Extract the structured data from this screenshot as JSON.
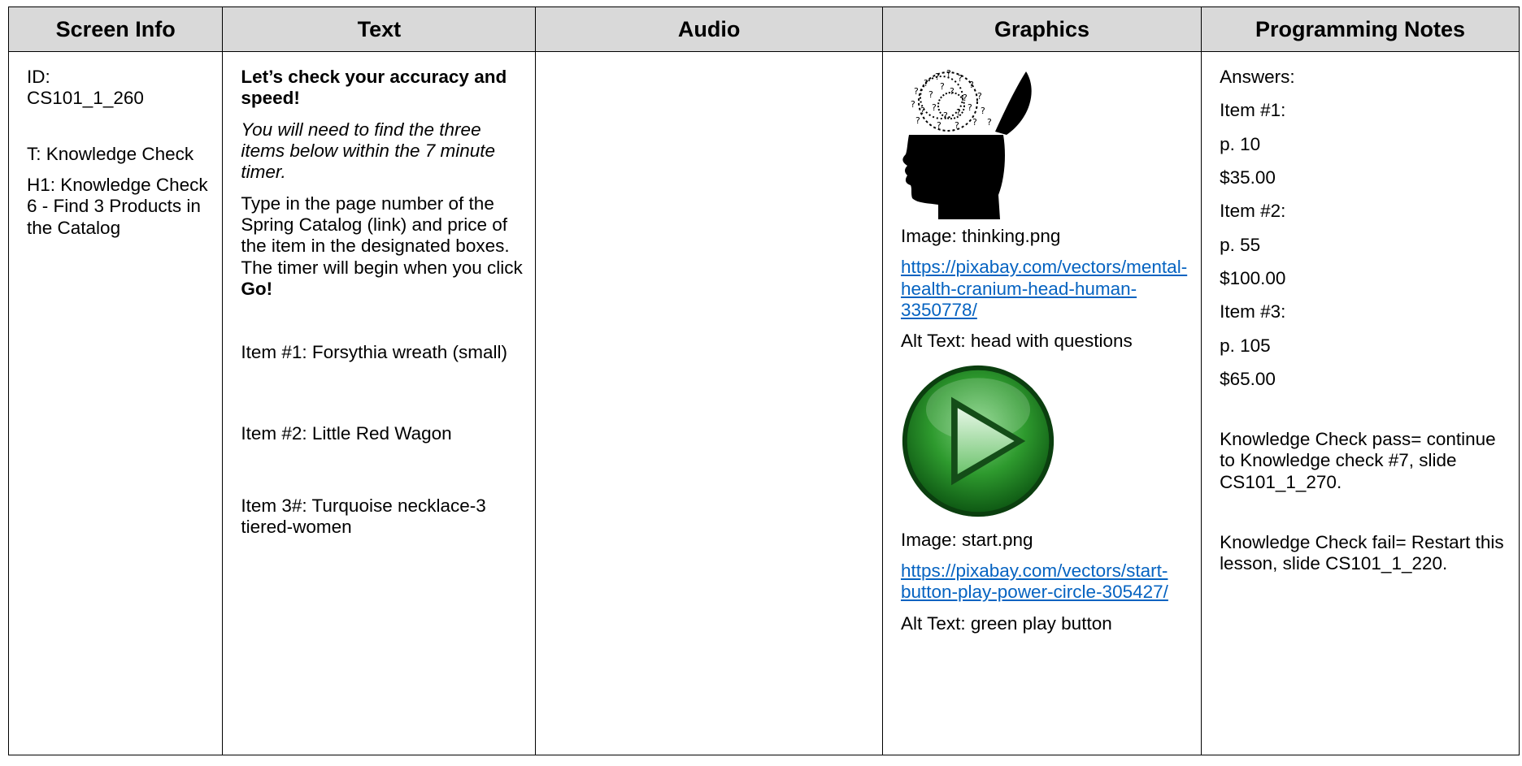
{
  "headers": {
    "screen_info": "Screen Info",
    "text": "Text",
    "audio": "Audio",
    "graphics": "Graphics",
    "programming_notes": "Programming Notes"
  },
  "screen_info": {
    "id_label": "ID:",
    "id_value": "CS101_1_260",
    "title": "T: Knowledge Check",
    "heading": "H1: Knowledge Check 6 - Find 3 Products in the Catalog"
  },
  "text": {
    "intro_bold": "Let’s check your accuracy and speed!",
    "instructions_italic": "You will need to find the three items below within the 7 minute timer.",
    "body_prefix": "Type in the page number of the Spring Catalog (link) and price of the item in the designated boxes. The timer will begin when you click",
    "body_go": "Go!",
    "item1": "Item #1: Forsythia wreath (small)",
    "item2": "Item #2: Little Red Wagon",
    "item3": "Item 3#: Turquoise necklace-3 tiered-women"
  },
  "audio": {},
  "graphics": {
    "image1_icon": "thinking-head-icon",
    "image1_label": "Image: thinking.png",
    "image1_url": "https://pixabay.com/vectors/mental-health-cranium-head-human-3350778/",
    "image1_alt": "Alt Text: head with questions",
    "image2_icon": "green-play-button-icon",
    "image2_label": "Image: start.png",
    "image2_url": "https://pixabay.com/vectors/start-button-play-power-circle-305427/",
    "image2_alt": "Alt Text: green play button"
  },
  "programming_notes": {
    "answers_label": "Answers:",
    "item1_label": "Item #1:",
    "item1_page": "p. 10",
    "item1_price": "$35.00",
    "item2_label": "Item #2:",
    "item2_page": "p. 55",
    "item2_price": "$100.00",
    "item3_label": "Item #3:",
    "item3_page": "p. 105",
    "item3_price": "$65.00",
    "pass_note": "Knowledge Check pass= continue to Knowledge check #7, slide CS101_1_270.",
    "fail_note": "Knowledge Check fail= Restart this lesson, slide CS101_1_220."
  },
  "colors": {
    "header_bg": "#d9d9d9",
    "link": "#0563c1",
    "play_green": "#2e9a2e"
  }
}
